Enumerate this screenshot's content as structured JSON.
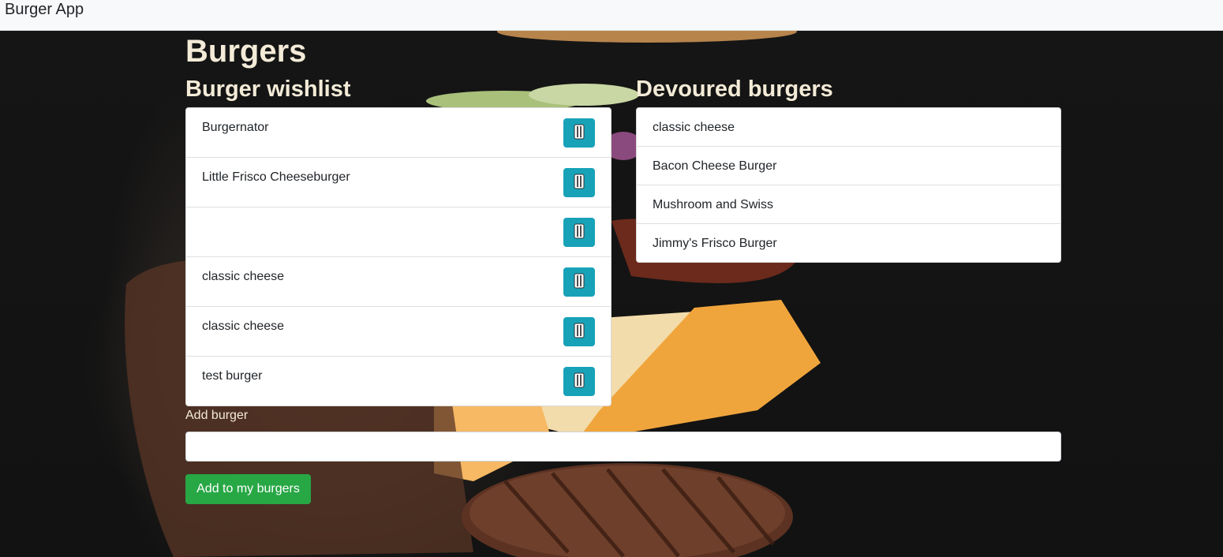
{
  "navbar": {
    "brand": "Burger App"
  },
  "page": {
    "title": "Burgers"
  },
  "wishlist": {
    "title": "Burger wishlist",
    "items": [
      {
        "name": "Burgernator"
      },
      {
        "name": "Little Frisco Cheeseburger"
      },
      {
        "name": ""
      },
      {
        "name": "classic cheese"
      },
      {
        "name": "classic cheese"
      },
      {
        "name": "test burger"
      }
    ],
    "button_icon": "fork-knife-icon"
  },
  "devoured": {
    "title": "Devoured burgers",
    "items": [
      {
        "name": "classic cheese"
      },
      {
        "name": "Bacon Cheese Burger"
      },
      {
        "name": "Mushroom and Swiss"
      },
      {
        "name": "Jimmy's Frisco Burger"
      }
    ]
  },
  "form": {
    "label": "Add burger",
    "value": "",
    "submit_label": "Add to my burgers"
  },
  "colors": {
    "eat_button": "#17a2b8",
    "submit_button": "#28a745",
    "heading": "#f3ebd7"
  }
}
